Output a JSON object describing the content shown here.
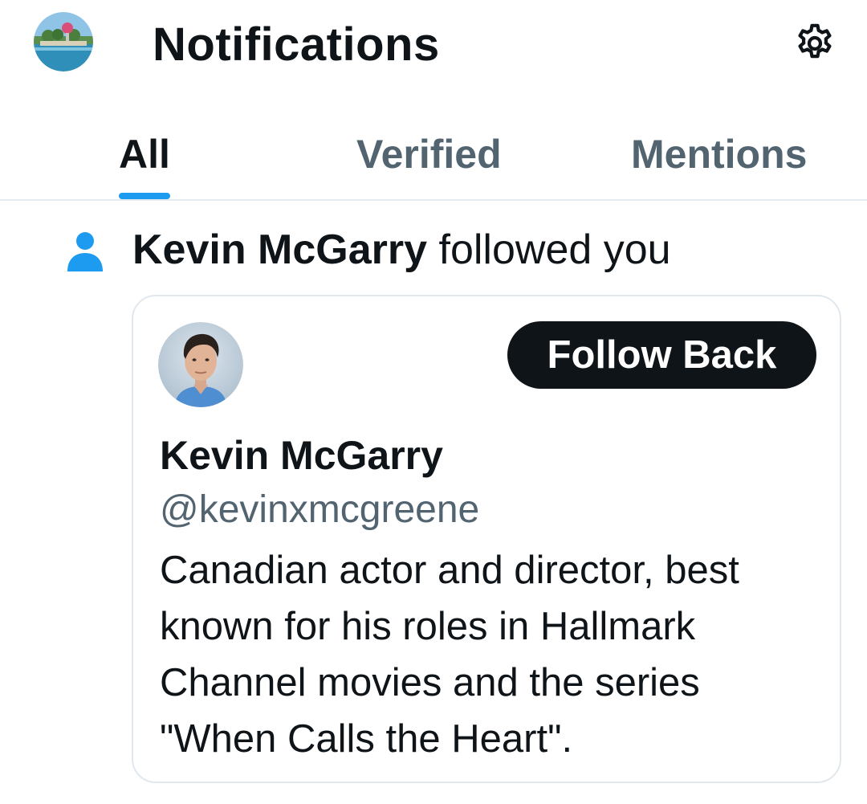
{
  "header": {
    "title": "Notifications",
    "avatar_icon": "profile-avatar-tropical-island",
    "settings_icon": "gear-icon"
  },
  "tabs": [
    {
      "label": "All",
      "active": true
    },
    {
      "label": "Verified",
      "active": false
    },
    {
      "label": "Mentions",
      "active": false
    }
  ],
  "notification": {
    "icon": "person-icon",
    "actor": "Kevin McGarry",
    "action": "followed you",
    "card": {
      "name": "Kevin McGarry",
      "handle": "@kevinxmcgreene",
      "bio": "Canadian actor and director, best known for his roles in Hallmark Channel movies and the series \"When Calls the Heart\".",
      "follow_label": "Follow Back"
    }
  },
  "colors": {
    "accent": "#1d9bf0",
    "text_primary": "#0f1419",
    "text_secondary": "#536471",
    "button_bg": "#0f1419",
    "border": "#e1e8ed"
  }
}
